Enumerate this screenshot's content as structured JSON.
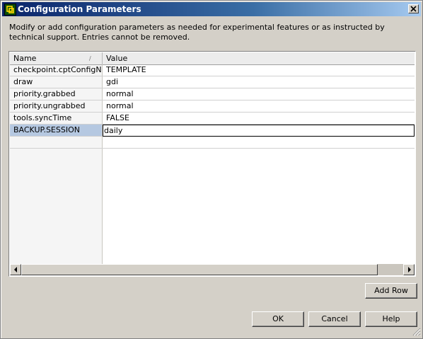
{
  "window": {
    "title": "Configuration Parameters",
    "app_icon": "vmware-icon",
    "close_icon": "close-icon"
  },
  "description": "Modify or add configuration parameters as needed for experimental features or as instructed by technical support. Entries cannot be removed.",
  "table": {
    "columns": [
      "Name",
      "Value"
    ],
    "sort_icon": "sort-icon",
    "rows": [
      {
        "name": "checkpoint.cptConfigN...",
        "value": "TEMPLATE"
      },
      {
        "name": "draw",
        "value": "gdi"
      },
      {
        "name": "priority.grabbed",
        "value": "normal"
      },
      {
        "name": "priority.ungrabbed",
        "value": "normal"
      },
      {
        "name": "tools.syncTime",
        "value": "FALSE"
      },
      {
        "name": "BACKUP.SESSION",
        "value": "daily"
      },
      {
        "name": "",
        "value": ""
      }
    ],
    "selected_row": 5
  },
  "buttons": {
    "add_row": "Add Row",
    "ok": "OK",
    "cancel": "Cancel",
    "help": "Help"
  }
}
